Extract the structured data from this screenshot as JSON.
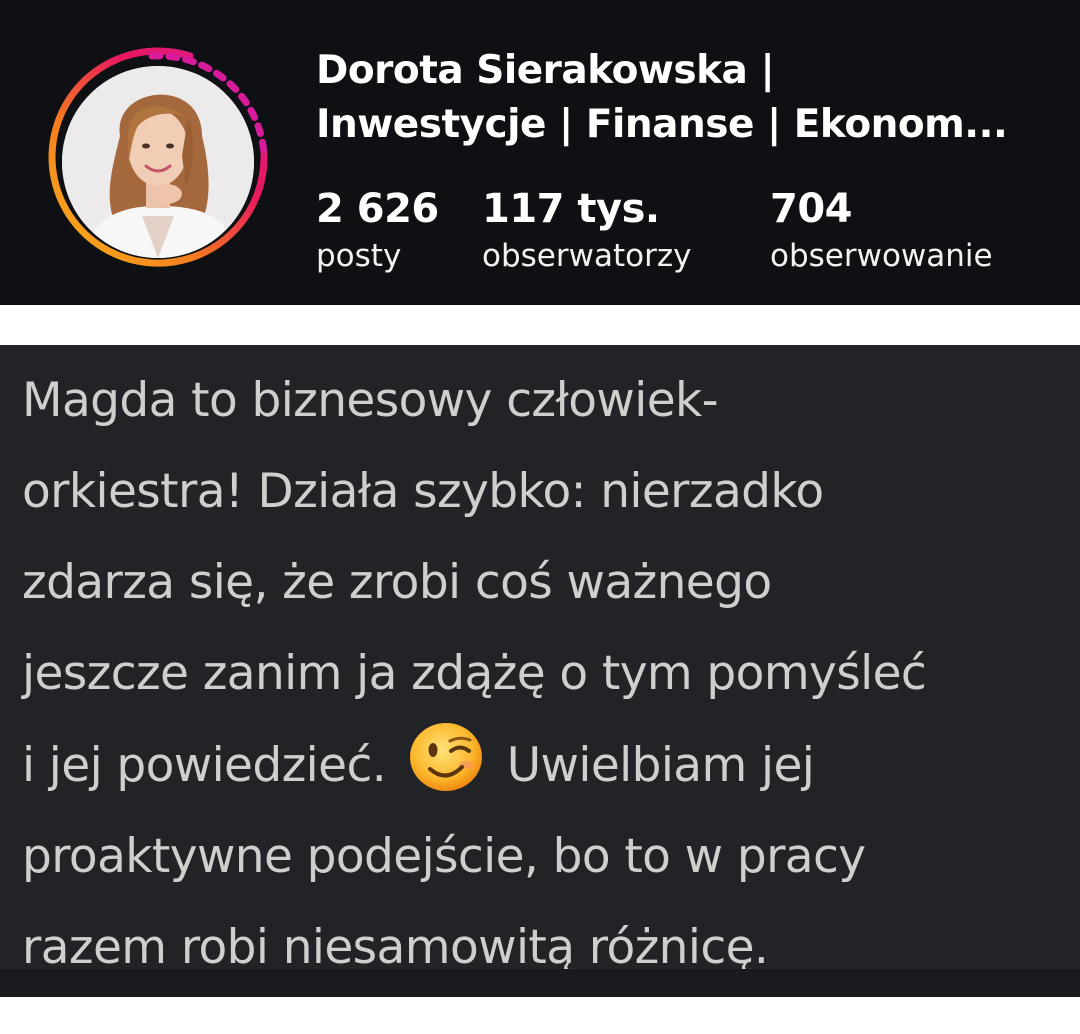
{
  "profile": {
    "name_line1": "Dorota Sierakowska |",
    "name_line2": "Inwestycje | Finanse | Ekonom...",
    "avatar_icon": "profile-photo",
    "story_ring_colors": [
      "#f9a825",
      "#f57c00",
      "#e91e63",
      "#c2185b",
      "#d81b9b"
    ],
    "stats": {
      "posts": {
        "value": "2 626",
        "label": "posty"
      },
      "followers": {
        "value": "117 tys.",
        "label": "obserwatorzy"
      },
      "following": {
        "value": "704",
        "label": "obserwowanie"
      }
    }
  },
  "quote": {
    "lines": [
      "Magda to biznesowy człowiek-",
      "orkiestra! Działa szybko: nierzadko",
      "zdarza się, że zrobi coś ważnego",
      "jeszcze zanim ja zdążę o tym pomyśleć"
    ],
    "line5_before": "i jej powiedzieć.",
    "line5_emoji": "winking-face-emoji",
    "line5_after": "Uwielbiam jej",
    "line6": "proaktywne podejście, bo to w pracy",
    "line7": "razem robi niesamowitą różnicę."
  },
  "colors": {
    "header_background": "#0f1013",
    "quote_background": "#222327",
    "quote_text": "#cfcfcf"
  }
}
